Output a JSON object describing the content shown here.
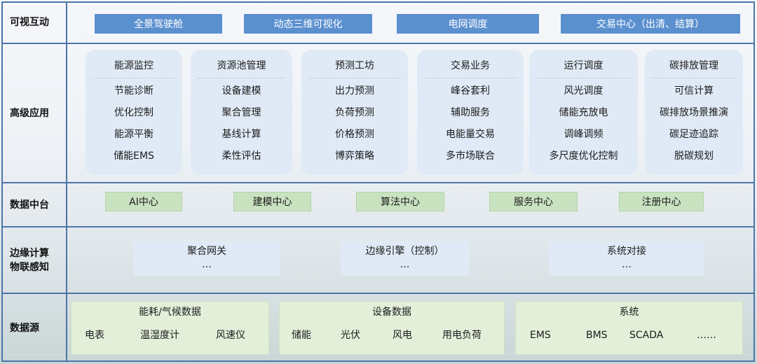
{
  "layers": {
    "interaction": "可视互动",
    "applications": "高级应用",
    "data_center": "数据中台",
    "edge_line1": "边缘计算",
    "edge_line2": "物联感知",
    "sources": "数据源"
  },
  "interaction_items": [
    "全景驾驶舱",
    "动态三维可视化",
    "电网调度",
    "交易中心（出清、结算）"
  ],
  "applications": [
    {
      "title": "能源监控",
      "items": [
        "节能诊断",
        "优化控制",
        "能源平衡",
        "储能EMS"
      ]
    },
    {
      "title": "资源池管理",
      "items": [
        "设备建模",
        "聚合管理",
        "基线计算",
        "柔性评估"
      ]
    },
    {
      "title": "预测工坊",
      "items": [
        "出力预测",
        "负荷预测",
        "价格预测",
        "博弈策略"
      ]
    },
    {
      "title": "交易业务",
      "items": [
        "峰谷套利",
        "辅助服务",
        "电能量交易",
        "多市场联合"
      ]
    },
    {
      "title": "运行调度",
      "items": [
        "风光调度",
        "储能充放电",
        "调峰调频",
        "多尺度优化控制"
      ]
    },
    {
      "title": "碳排放管理",
      "items": [
        "可信计算",
        "碳排放场景推演",
        "碳足迹追踪",
        "脱碳规划"
      ]
    }
  ],
  "data_center_items": [
    "AI中心",
    "建模中心",
    "算法中心",
    "服务中心",
    "注册中心"
  ],
  "edge_items": [
    {
      "title": "聚合网关",
      "detail": "…"
    },
    {
      "title": "边缘引擎（控制）",
      "detail": "…"
    },
    {
      "title": "系统对接",
      "detail": "…"
    }
  ],
  "sources": [
    {
      "title": "能耗/气候数据",
      "items": [
        "电表",
        "温湿度计",
        "风速仪"
      ]
    },
    {
      "title": "设备数据",
      "items": [
        "储能",
        "光伏",
        "风电",
        "用电负荷"
      ]
    },
    {
      "title": "系统",
      "items": [
        "EMS",
        "BMS",
        "SCADA",
        "……"
      ]
    }
  ],
  "colors": {
    "frame": "#4d74a8",
    "interaction_button": "#5b90cf",
    "data_center_button": "#c9e2c0",
    "source_box": "#e3efd9",
    "app_card": "#dee9f6"
  }
}
